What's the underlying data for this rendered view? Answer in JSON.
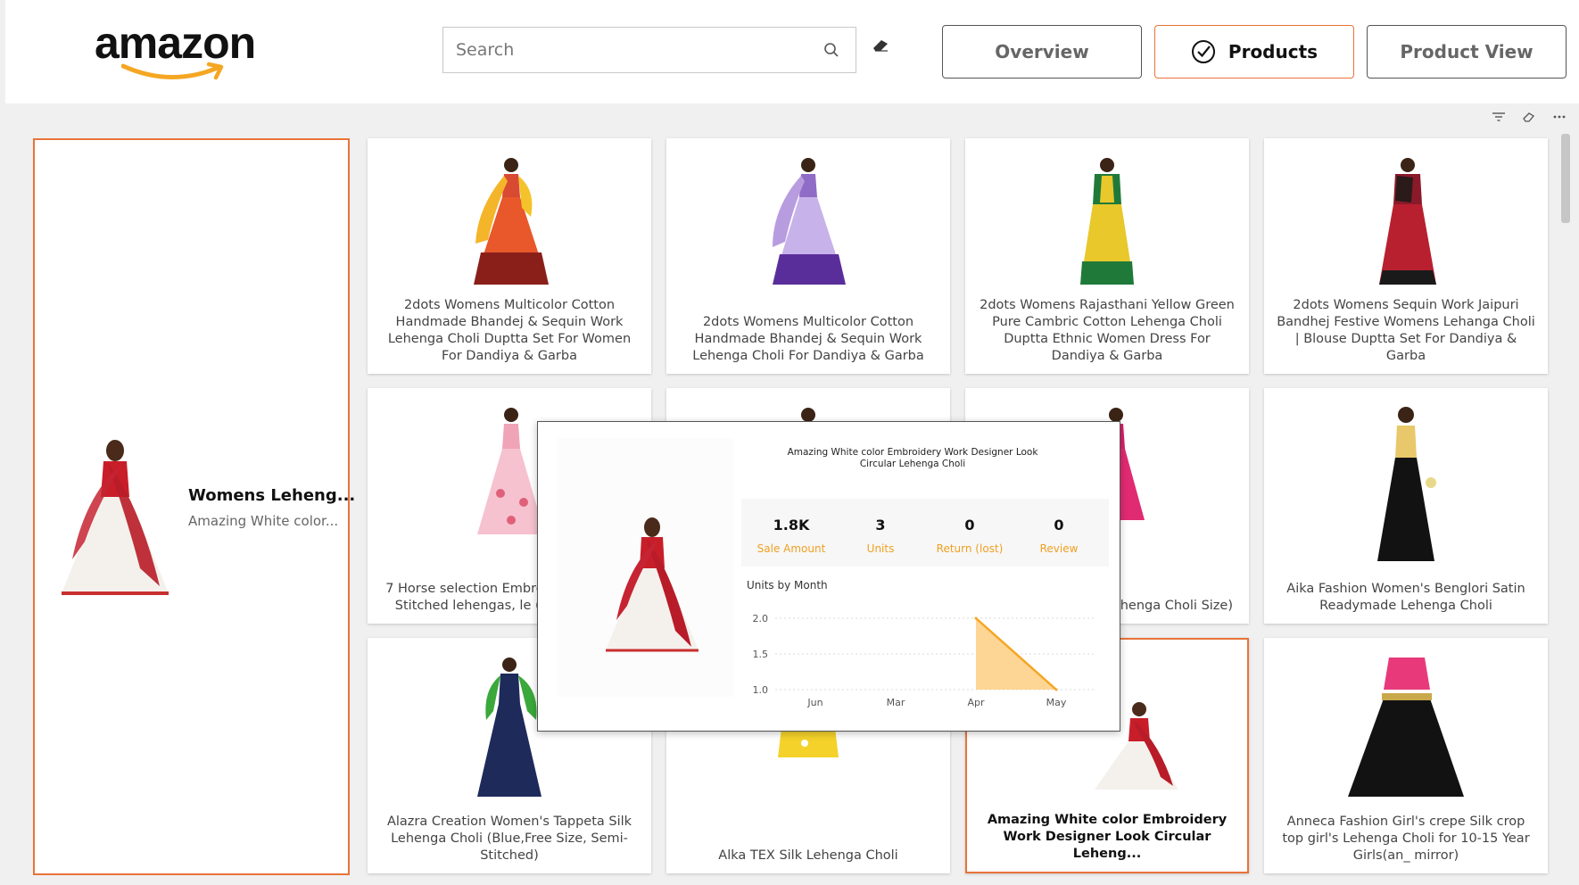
{
  "brand": {
    "logo_text": "amazon",
    "accent": "#e8733a",
    "logo_smile": "#f5a623"
  },
  "search": {
    "placeholder": "Search"
  },
  "nav": [
    {
      "label": "Overview",
      "active": false
    },
    {
      "label": "Products",
      "active": true
    },
    {
      "label": "Product View",
      "active": false
    }
  ],
  "toolbar_icons": [
    "filter-icon",
    "eraser-icon",
    "more-icon"
  ],
  "featured": {
    "name": "Womens Leheng...",
    "subtitle": "Amazing White color..."
  },
  "products": [
    {
      "caption": "2dots Womens Multicolor Cotton Handmade Bhandej & Sequin Work Lehenga Choli Duptta Set For Women For Dandiya & Garba",
      "selected": false
    },
    {
      "caption": "2dots Womens Multicolor Cotton Handmade Bhandej & Sequin Work Lehenga Choli For Dandiya & Garba",
      "selected": false
    },
    {
      "caption": "2dots Womens Rajasthani Yellow Green Pure Cambric Cotton Lehenga Choli Duptta Ethnic Women Dress For Dandiya & Garba",
      "selected": false
    },
    {
      "caption": "2dots Womens Sequin Work Jaipuri Bandhej Festive Womens Lehanga Choli | Blouse Duptta Set For Dandiya & Garba",
      "selected": false
    },
    {
      "caption": "7 Horse selection Embroidered multi c Stitched lehengas, le (MULTI_FREE_",
      "selected": false
    },
    {
      "caption": "",
      "selected": false
    },
    {
      "caption": "'s Banglori Satin ehenga Choli Size)",
      "selected": false
    },
    {
      "caption": "Aika Fashion Women's Benglori Satin Readymade Lehenga Choli",
      "selected": false
    },
    {
      "caption": "Alazra Creation Women's Tappeta Silk Lehenga Choli (Blue,Free Size, Semi-Stitched)",
      "selected": false
    },
    {
      "caption": "Alka TEX Silk Lehenga Choli",
      "selected": false
    },
    {
      "caption": "Amazing White color Embroidery Work Designer Look Circular Leheng...",
      "selected": true
    },
    {
      "caption": "Anneca Fashion Girl's crepe Silk crop top girl's Lehenga Choli for 10-15 Year Girls(an_ mirror)",
      "selected": false
    }
  ],
  "tooltip": {
    "title": "Amazing White color Embroidery Work Designer Look Circular Lehenga Choli",
    "kpis": [
      {
        "value": "1.8K",
        "label": "Sale Amount"
      },
      {
        "value": "3",
        "label": "Units"
      },
      {
        "value": "0",
        "label": "Return (lost)"
      },
      {
        "value": "0",
        "label": "Review"
      }
    ],
    "chart_title": "Units by Month"
  },
  "chart_data": {
    "type": "area",
    "title": "Units by Month",
    "categories": [
      "Jun",
      "Mar",
      "Apr",
      "May"
    ],
    "values": [
      null,
      null,
      2,
      1
    ],
    "yticks": [
      "2.0",
      "1.5",
      "1.0"
    ],
    "ylim": [
      1,
      2
    ],
    "grid": true,
    "color": "#f5a623",
    "fill": "#fdd08a"
  }
}
